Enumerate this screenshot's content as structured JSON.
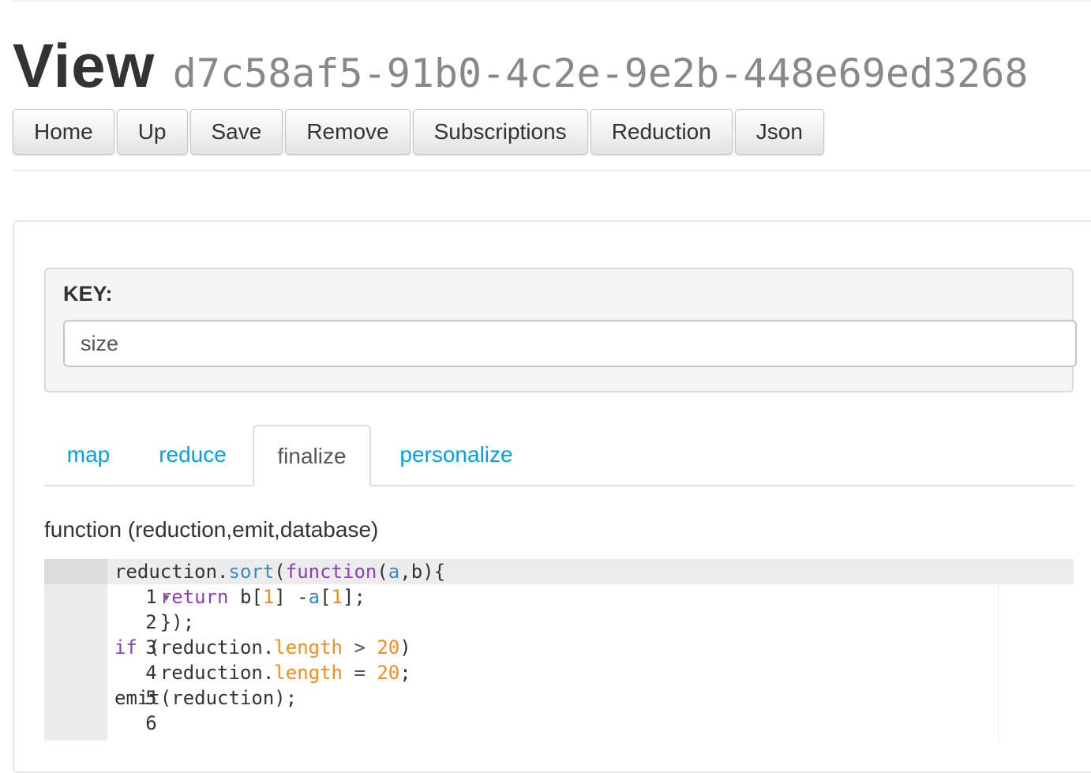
{
  "header": {
    "title": "View",
    "id": "d7c58af5-91b0-4c2e-9e2b-448e69ed3268"
  },
  "toolbar": [
    "Home",
    "Up",
    "Save",
    "Remove",
    "Subscriptions",
    "Reduction",
    "Json"
  ],
  "key": {
    "label": "KEY:",
    "value": "size"
  },
  "tabs": {
    "map": "map",
    "reduce": "reduce",
    "finalize": "finalize",
    "personalize": "personalize",
    "active": "finalize"
  },
  "signature": "function (reduction,emit,database)",
  "editor": {
    "line_numbers": [
      "1",
      "2",
      "3",
      "4",
      "5",
      "6"
    ],
    "fold_icon": "triangle-down"
  }
}
